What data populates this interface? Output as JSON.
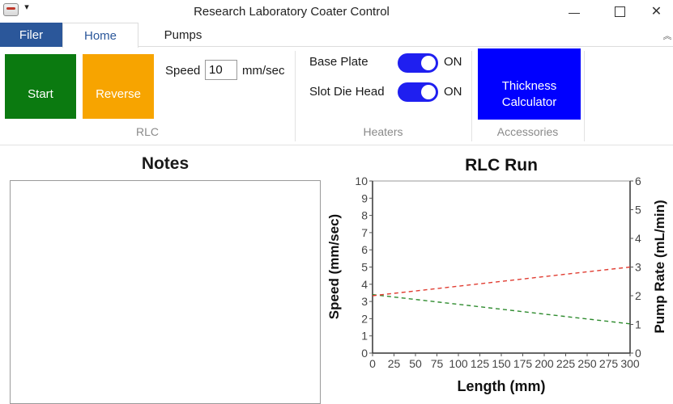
{
  "window": {
    "title": "Research Laboratory Coater Control",
    "app_icon": "coater-app-icon",
    "quick_access_glyph": "▾",
    "close_glyph": "✕"
  },
  "tabs": {
    "filer": "Filer",
    "home": "Home",
    "pumps": "Pumps",
    "collapse_glyph": "︽"
  },
  "ribbon": {
    "rlc": {
      "start_label": "Start",
      "reverse_label": "Reverse",
      "speed_label": "Speed",
      "speed_value": "10",
      "speed_unit": "mm/sec",
      "group_label": "RLC"
    },
    "heaters": {
      "base_plate_label": "Base Plate",
      "base_plate_state": "ON",
      "base_plate_on": true,
      "slot_die_label": "Slot Die Head",
      "slot_die_state": "ON",
      "slot_die_on": true,
      "group_label": "Heaters"
    },
    "accessories": {
      "thickness_line1": "Thickness",
      "thickness_line2": "Calculator",
      "group_label": "Accessories"
    }
  },
  "colors": {
    "filer_tab": "#2b579a",
    "start": "#0b7a10",
    "reverse": "#f7a400",
    "toggle_on": "#1f1ff0",
    "thickness": "#0000ff",
    "speed_line": "#2e8b2e",
    "pump_line": "#e03c31"
  },
  "notes": {
    "title": "Notes",
    "value": ""
  },
  "chart_data": {
    "type": "line",
    "title": "RLC Run",
    "xlabel": "Length (mm)",
    "ylabel": "Speed (mm/sec)",
    "y2label": "Pump Rate (mL/min)",
    "xlim": [
      0,
      300
    ],
    "ylim": [
      0,
      10
    ],
    "y2lim": [
      0,
      6
    ],
    "x_ticks": [
      0,
      25,
      50,
      75,
      100,
      125,
      150,
      175,
      200,
      225,
      250,
      275,
      300
    ],
    "y_ticks": [
      0,
      1,
      2,
      3,
      4,
      5,
      6,
      7,
      8,
      9,
      10
    ],
    "y2_ticks": [
      0,
      1,
      2,
      3,
      4,
      5,
      6
    ],
    "grid": false,
    "series": [
      {
        "axis": "left",
        "color": "#2e8b2e",
        "style": "dashed",
        "x": [
          0,
          300
        ],
        "y": [
          3.4,
          1.7
        ]
      },
      {
        "axis": "right",
        "color": "#e03c31",
        "style": "dashed",
        "x": [
          0,
          300
        ],
        "y": [
          2.0,
          3.0
        ]
      }
    ]
  }
}
